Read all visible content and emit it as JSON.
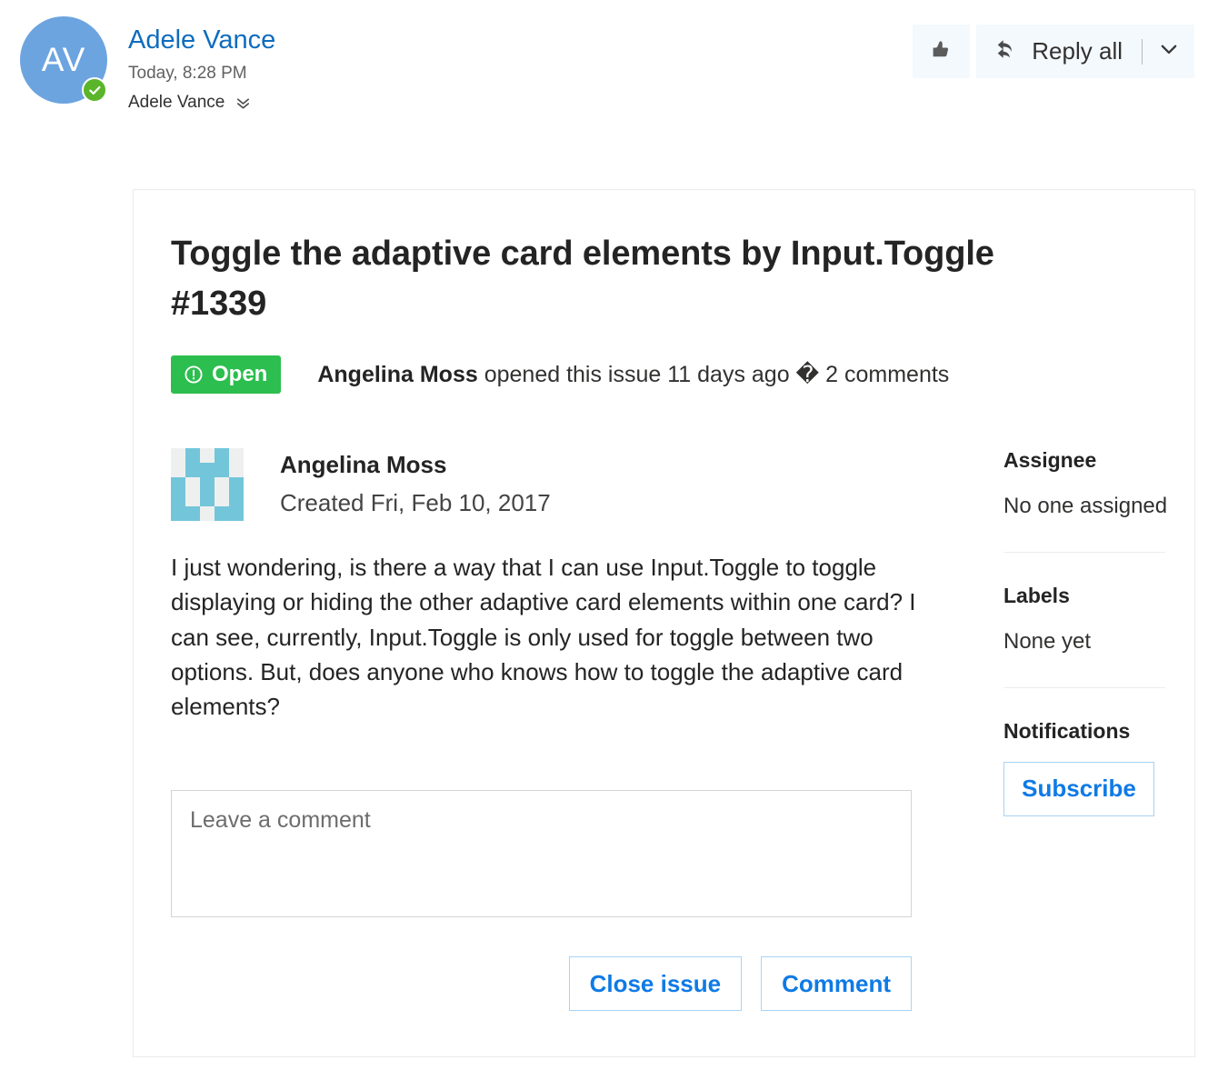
{
  "email_header": {
    "avatar_initials": "AV",
    "avatar_color": "#6ca4e0",
    "presence_icon": "checkmark-circle-icon",
    "presence_color": "#5ab52a",
    "sender_name": "Adele Vance",
    "sender_name_color": "#0f6cbd",
    "sent_time": "Today, 8:28 PM",
    "recipients": "Adele Vance",
    "expand_icon": "double-chevron-down-icon",
    "actions": {
      "like_icon": "thumbs-up-icon",
      "reply_all_icon": "reply-all-arrow-icon",
      "reply_all_label": "Reply all",
      "dropdown_icon": "chevron-down-icon"
    }
  },
  "issue": {
    "title": "Toggle the adaptive card elements by Input.Toggle #1339",
    "status": {
      "label": "Open",
      "icon": "circle-exclamation-icon",
      "color": "#2cbe4e"
    },
    "meta": {
      "author": "Angelina Moss",
      "action": " opened this issue 11 days ago ",
      "separator": "�",
      "comments": " 2 comments"
    },
    "comment": {
      "avatar_icon": "identicon-avatar",
      "avatar_color": "#73c6d9",
      "avatar_bg": "#eef0f0",
      "author": "Angelina Moss",
      "created": "Created Fri, Feb 10, 2017",
      "body": "I just wondering, is there a way that I can use Input.Toggle to toggle displaying or hiding the other adaptive card elements within one card? I can see, currently, Input.Toggle is only used for toggle between two options. But, does anyone who knows how to toggle the adaptive card elements?"
    },
    "form": {
      "placeholder": "Leave a comment",
      "value": "",
      "close_label": "Close issue",
      "comment_label": "Comment",
      "accent_color": "#0f7ae5"
    },
    "sidebar": {
      "assignee_heading": "Assignee",
      "assignee_value": "No one assigned",
      "labels_heading": "Labels",
      "labels_value": "None yet",
      "notifications_heading": "Notifications",
      "subscribe_label": "Subscribe"
    }
  }
}
